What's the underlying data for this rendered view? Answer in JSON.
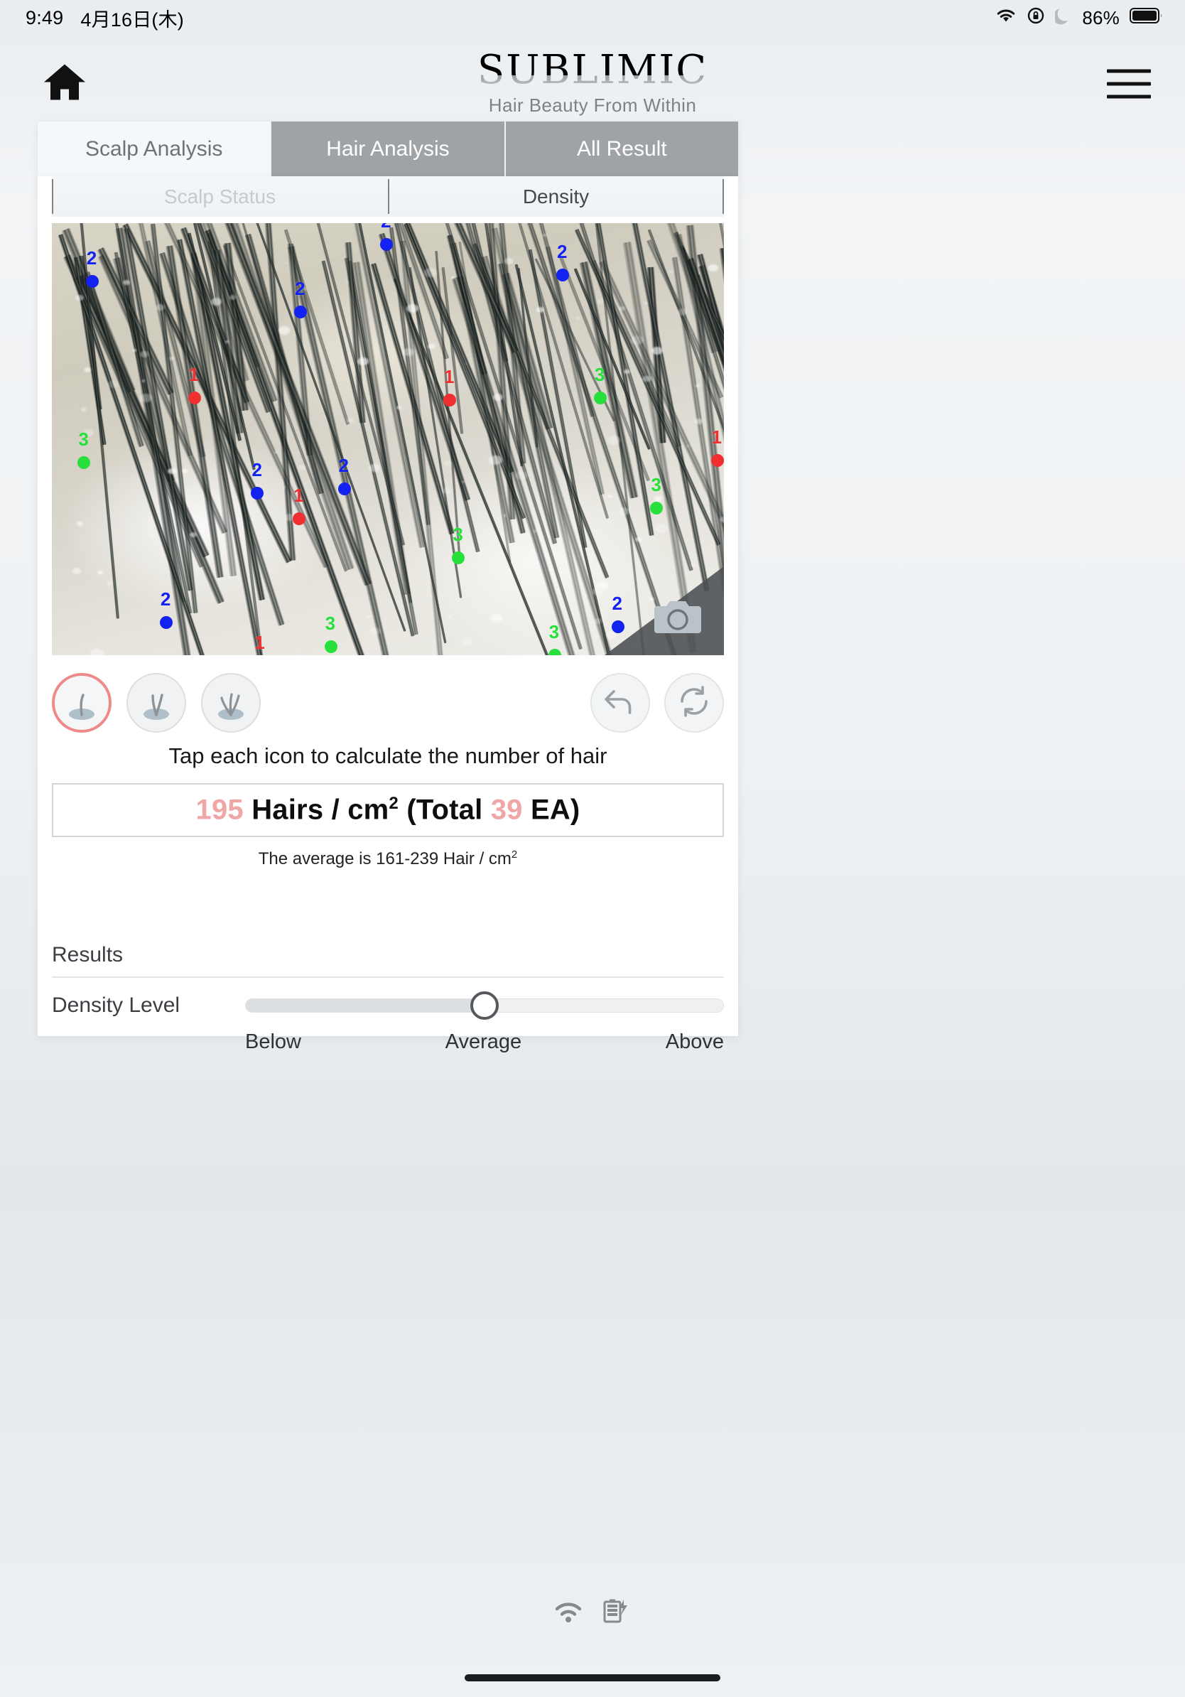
{
  "status_bar": {
    "time": "9:49",
    "date": "4月16日(木)",
    "battery_percent": "86%",
    "icons": [
      "wifi-icon",
      "rotation-lock-icon",
      "do-not-disturb-moon-icon",
      "battery-icon"
    ]
  },
  "header": {
    "home_icon": "home-icon",
    "menu_icon": "hamburger-menu-icon",
    "brand_name": "SUBLIMIC",
    "brand_tagline": "Hair Beauty From Within"
  },
  "tabs": [
    {
      "label": "Scalp Analysis",
      "active": true
    },
    {
      "label": "Hair Analysis",
      "active": false
    },
    {
      "label": "All Result",
      "active": false
    }
  ],
  "subtabs": [
    {
      "label": "Scalp Status",
      "active": false
    },
    {
      "label": "Density",
      "active": true
    }
  ],
  "scalp_image": {
    "camera_icon": "camera-icon",
    "markers": [
      {
        "n": "2",
        "color": "blue",
        "x": 6.0,
        "y": 13.5
      },
      {
        "n": "2",
        "color": "blue",
        "x": 37.0,
        "y": 20.5
      },
      {
        "n": "2",
        "color": "blue",
        "x": 49.8,
        "y": 5.0
      },
      {
        "n": "2",
        "color": "blue",
        "x": 76.0,
        "y": 12.0
      },
      {
        "n": "1",
        "color": "red",
        "x": 21.2,
        "y": 40.5
      },
      {
        "n": "1",
        "color": "red",
        "x": 59.2,
        "y": 41.0
      },
      {
        "n": "3",
        "color": "green",
        "x": 81.6,
        "y": 40.5
      },
      {
        "n": "3",
        "color": "green",
        "x": 4.8,
        "y": 55.5
      },
      {
        "n": "1",
        "color": "red",
        "x": 99.0,
        "y": 55.0
      },
      {
        "n": "2",
        "color": "blue",
        "x": 30.6,
        "y": 62.5
      },
      {
        "n": "2",
        "color": "blue",
        " x2": 0,
        "x": 43.5,
        "y": 61.5
      },
      {
        "n": "1",
        "color": "red",
        "x": 36.8,
        "y": 68.5
      },
      {
        "n": "3",
        "color": "green",
        "x": 90.0,
        "y": 66.0
      },
      {
        "n": "3",
        "color": "green",
        "x": 60.5,
        "y": 77.5
      },
      {
        "n": "2",
        "color": "blue",
        "x": 17.0,
        "y": 92.5
      },
      {
        "n": "2",
        "color": "blue",
        "x": 84.2,
        "y": 93.5
      },
      {
        "n": "3",
        "color": "green",
        "x": 41.5,
        "y": 98.0
      },
      {
        "n": "3",
        "color": "green",
        "x": 74.8,
        "y": 100.0
      },
      {
        "n": "1",
        "color": "red",
        "x": 31.0,
        "y": 102.5
      }
    ]
  },
  "hair_count_tools": {
    "icons": [
      {
        "name": "one-hair-follicle-icon",
        "strands": 1,
        "selected": true
      },
      {
        "name": "two-hair-follicle-icon",
        "strands": 2,
        "selected": false
      },
      {
        "name": "three-hair-follicle-icon",
        "strands": 3,
        "selected": false
      }
    ],
    "undo_icon": "undo-arrow-icon",
    "reset_icon": "reset-refresh-icon"
  },
  "instruction": "Tap each icon to calculate the number of hair",
  "result": {
    "density_value": "195",
    "density_unit_prefix": "Hairs / cm",
    "density_unit_sup": "2",
    "total_prefix": "(Total ",
    "total_value": "39",
    "total_suffix": " EA)",
    "average_note_prefix": "The average is 161-239 Hair / cm",
    "average_note_sup": "2",
    "highlight_color": "#f0a6a6"
  },
  "results_section": {
    "title": "Results",
    "density_level_label": "Density Level",
    "slider_position_percent": 50,
    "scale": {
      "left": "Below",
      "center": "Average",
      "right": "Above"
    }
  },
  "bottom_bar": {
    "icons": [
      "wifi-icon",
      "battery-charging-icon"
    ]
  }
}
